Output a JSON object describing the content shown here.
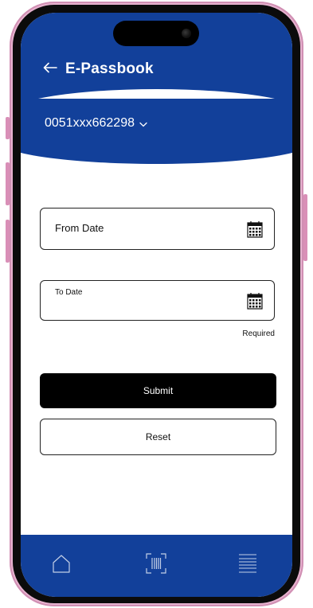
{
  "header": {
    "back_icon": "back-arrow-icon",
    "title": "E-Passbook"
  },
  "account": {
    "number": "0051xxx662298",
    "dropdown_icon": "chevron-down-icon"
  },
  "form": {
    "from_date": {
      "label": "From Date",
      "icon": "calendar-icon"
    },
    "to_date": {
      "label": "To Date",
      "icon": "calendar-icon",
      "helper": "Required"
    },
    "submit_label": "Submit",
    "reset_label": "Reset"
  },
  "bottom_nav": {
    "items": [
      {
        "icon": "home-icon"
      },
      {
        "icon": "barcode-scan-icon"
      },
      {
        "icon": "menu-icon"
      }
    ]
  },
  "colors": {
    "brand": "#12409a",
    "primary_button": "#000000",
    "phone_frame": "#e7b2cf"
  }
}
